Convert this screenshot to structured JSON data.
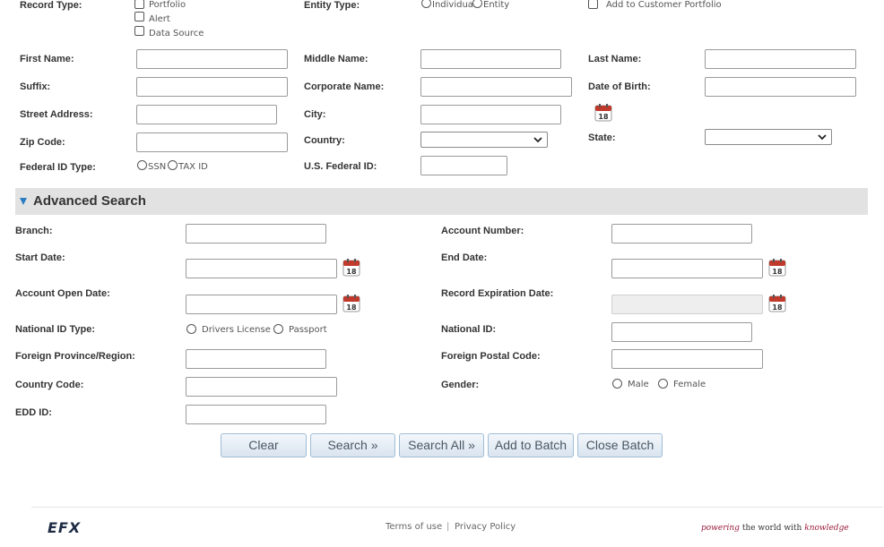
{
  "basic": {
    "record_type_label": "Record Type:",
    "record_types": [
      "Portfolio",
      "Alert",
      "Data Source"
    ],
    "entity_type_label": "Entity Type:",
    "entity_types": [
      "Individual",
      "Entity"
    ],
    "add_portfolio_label": "Add to Customer Portfolio",
    "first_name": "First Name:",
    "middle_name": "Middle Name:",
    "last_name": "Last Name:",
    "suffix": "Suffix:",
    "corporate_name": "Corporate Name:",
    "dob": "Date of Birth:",
    "street": "Street Address:",
    "city": "City:",
    "zip": "Zip Code:",
    "country": "Country:",
    "state": "State:",
    "federal_id_type": "Federal ID Type:",
    "federal_id_types": [
      "SSN",
      "TAX ID"
    ],
    "us_federal_id": "U.S. Federal ID:"
  },
  "advanced": {
    "title": "Advanced Search",
    "branch": "Branch:",
    "account_number": "Account Number:",
    "start_date": "Start Date:",
    "end_date": "End Date:",
    "account_open_date": "Account Open Date:",
    "record_expiration_date": "Record Expiration Date:",
    "national_id_type": "National ID Type:",
    "national_id_types": [
      "Drivers License",
      "Passport"
    ],
    "national_id": "National ID:",
    "foreign_province": "Foreign Province/Region:",
    "foreign_postal": "Foreign Postal Code:",
    "country_code": "Country Code:",
    "gender": "Gender:",
    "genders": [
      "Male",
      "Female"
    ],
    "edd_id": "EDD ID:"
  },
  "calendar_day": "18",
  "buttons": {
    "clear": "Clear",
    "search": "Search »",
    "search_all": "Search All »",
    "add_to_batch": "Add to Batch",
    "close_batch": "Close Batch"
  },
  "footer": {
    "logo": "EFX",
    "terms": "Terms of use",
    "separator": "|",
    "privacy": "Privacy Policy",
    "tagline_a": "powering",
    "tagline_b": "the world with",
    "tagline_c": "knowledge"
  },
  "colors": {
    "accent": "#2b7cc3",
    "calendar_red": "#c0392b",
    "button_text": "#4a5865",
    "tagline": "#9b1c3b"
  }
}
